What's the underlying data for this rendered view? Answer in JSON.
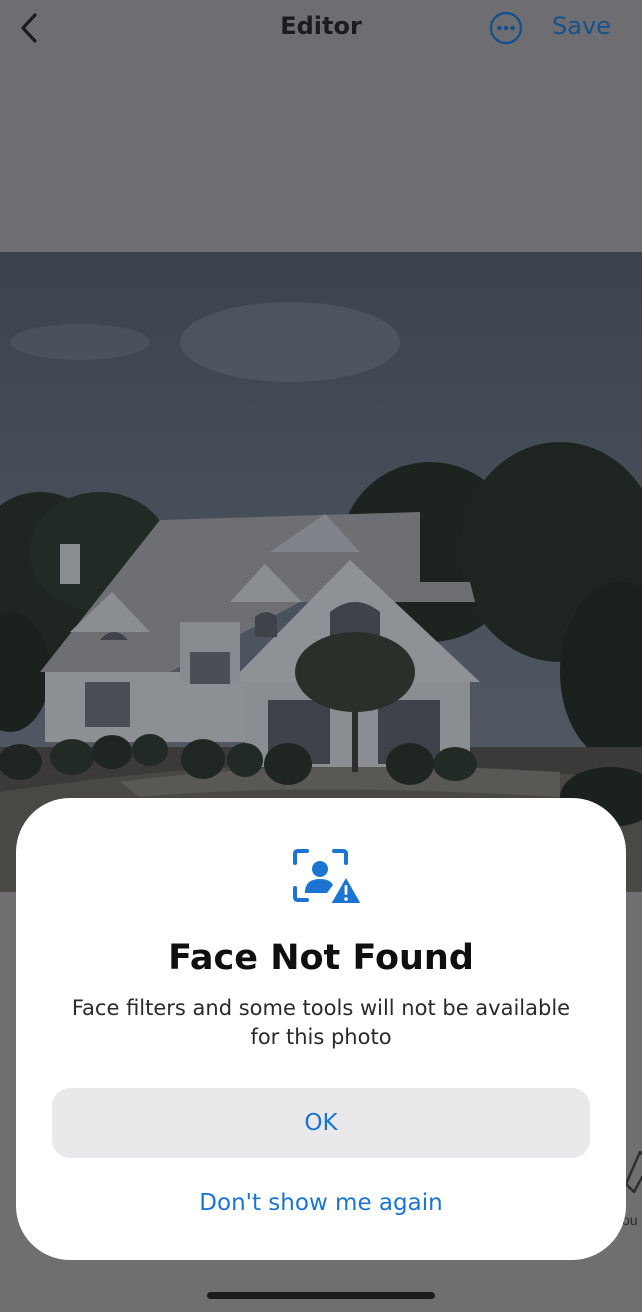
{
  "header": {
    "title": "Editor",
    "save_label": "Save",
    "back_icon": "chevron-left-icon",
    "more_icon": "more-horizontal-circle-icon"
  },
  "colors": {
    "accent": "#1b75d0",
    "nav_accent": "#15518a",
    "dim_overlay": "#6e6e72",
    "sheet_bg": "#ffffff",
    "button_bg": "#e9e9eb"
  },
  "dialog": {
    "icon": "face-warning-icon",
    "title": "Face Not Found",
    "message": "Face filters and some tools will not be available for this photo",
    "primary_label": "OK",
    "secondary_label": "Don't show me again"
  },
  "side_tool": {
    "label": "ou"
  }
}
